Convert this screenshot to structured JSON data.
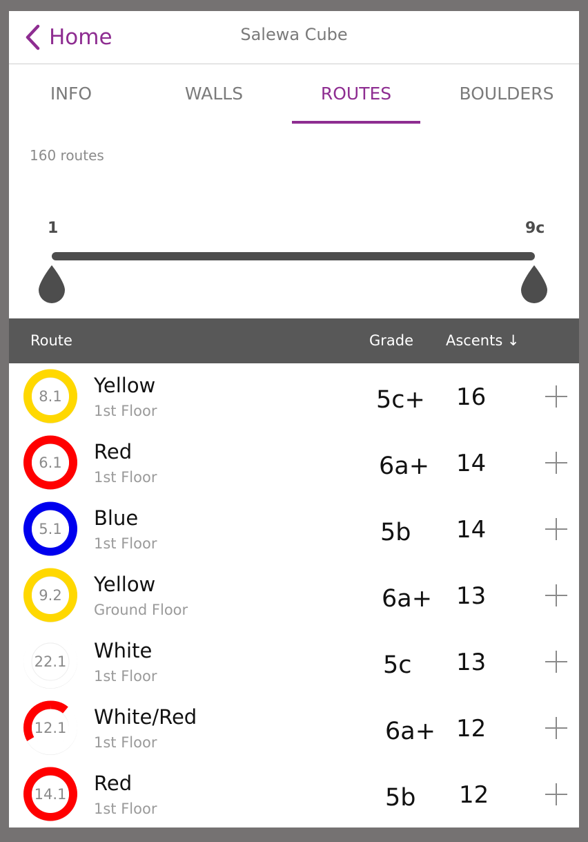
{
  "header": {
    "back_label": "Home",
    "title": "Salewa Cube"
  },
  "tabs": [
    {
      "label": "INFO",
      "active": false
    },
    {
      "label": "WALLS",
      "active": false
    },
    {
      "label": "ROUTES",
      "active": true
    },
    {
      "label": "BOULDERS",
      "active": false
    }
  ],
  "route_count": "160 routes",
  "grade_filter": {
    "min_label": "1",
    "max_label": "9c"
  },
  "table": {
    "col_route": "Route",
    "col_grade": "Grade",
    "col_ascents": "Ascents ↓",
    "rows": [
      {
        "number": "8.1",
        "name": "Yellow",
        "floor": "1st Floor",
        "grade": "5c+",
        "ascents": "16",
        "colors": [
          "#ffd800"
        ]
      },
      {
        "number": "6.1",
        "name": "Red",
        "floor": "1st Floor",
        "grade": "6a+",
        "ascents": "14",
        "colors": [
          "#ff0000"
        ]
      },
      {
        "number": "5.1",
        "name": "Blue",
        "floor": "1st Floor",
        "grade": "5b",
        "ascents": "14",
        "colors": [
          "#0000ee"
        ]
      },
      {
        "number": "9.2",
        "name": "Yellow",
        "floor": "Ground Floor",
        "grade": "6a+",
        "ascents": "13",
        "colors": [
          "#ffd800"
        ]
      },
      {
        "number": "22.1",
        "name": "White",
        "floor": "1st Floor",
        "grade": "5c",
        "ascents": "13",
        "colors": [
          "#ffffff"
        ]
      },
      {
        "number": "12.1",
        "name": "White/Red",
        "floor": "1st Floor",
        "grade": "6a+",
        "ascents": "12",
        "colors": [
          "#ffffff",
          "#ff0000"
        ]
      },
      {
        "number": "14.1",
        "name": "Red",
        "floor": "1st Floor",
        "grade": "5b",
        "ascents": "12",
        "colors": [
          "#ff0000"
        ]
      }
    ]
  },
  "accent_color": "#8e2d91"
}
